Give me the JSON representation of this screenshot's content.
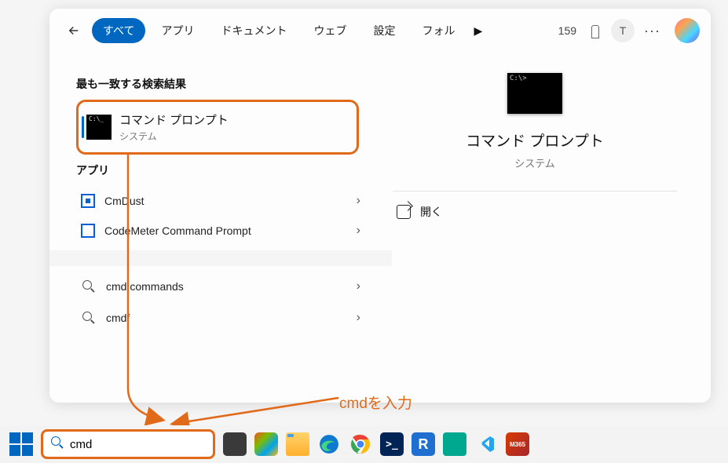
{
  "header": {
    "tabs": [
      "すべて",
      "アプリ",
      "ドキュメント",
      "ウェブ",
      "設定",
      "フォル"
    ],
    "active_tab": 0,
    "points": "159",
    "avatar_letter": "T"
  },
  "left": {
    "section_best": "最も一致する検索結果",
    "primary": {
      "title": "コマンド プロンプト",
      "subtitle": "システム"
    },
    "section_apps": "アプリ",
    "apps": [
      {
        "name": "CmDust"
      },
      {
        "name": "CodeMeter Command Prompt"
      }
    ],
    "suggests": [
      {
        "text": "cmd commands"
      },
      {
        "text": "cmdf"
      }
    ]
  },
  "right": {
    "title": "コマンド プロンプト",
    "subtitle": "システム",
    "open_label": "開く"
  },
  "taskbar": {
    "search_value": "cmd"
  },
  "annotation": {
    "text": "cmdを入力"
  }
}
